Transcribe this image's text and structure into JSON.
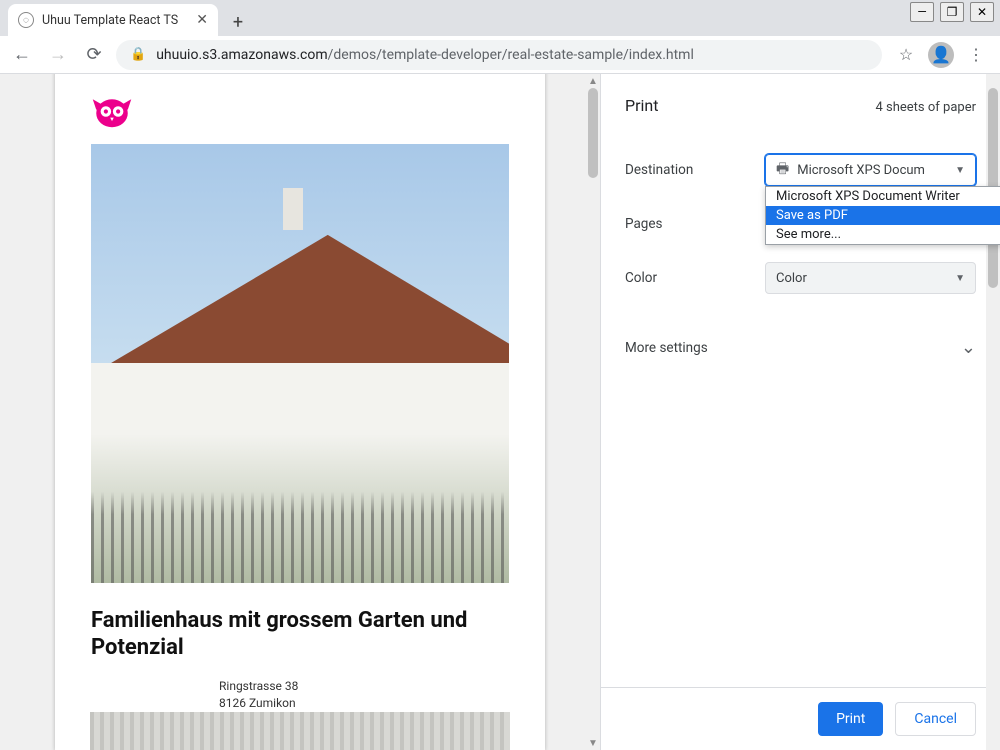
{
  "window": {
    "minimize_glyph": "—",
    "maximize_glyph": "❐",
    "close_glyph": "✕"
  },
  "tab": {
    "title": "Uhuu Template React TS",
    "favicon_glyph": "◌",
    "close_glyph": "✕",
    "newtab_glyph": "+"
  },
  "toolbar": {
    "back_glyph": "←",
    "forward_glyph": "→",
    "reload_glyph": "⟳",
    "lock_glyph": "🔒",
    "url_host": "uhuuio.s3.amazonaws.com",
    "url_path": "/demos/template-developer/real-estate-sample/index.html",
    "star_glyph": "☆",
    "avatar_glyph": "👤",
    "menu_glyph": "⋮"
  },
  "document": {
    "title": "Familienhaus mit grossem Garten und Potenzial",
    "address_line1": "Ringstrasse 38",
    "address_line2": "8126 Zumikon"
  },
  "print": {
    "title": "Print",
    "sheet_count": "4 sheets of paper",
    "rows": {
      "destination_label": "Destination",
      "pages_label": "Pages",
      "color_label": "Color",
      "more_label": "More settings"
    },
    "destination": {
      "selected_display": "Microsoft XPS Docum",
      "options": {
        "opt0": "Microsoft XPS Document Writer",
        "opt1": "Save as PDF",
        "opt2": "See more..."
      },
      "printer_glyph": "🖶"
    },
    "color": {
      "selected_display": "Color"
    },
    "buttons": {
      "print": "Print",
      "cancel": "Cancel"
    },
    "caret_glyph": "▼",
    "chevron_glyph": "⌄"
  }
}
